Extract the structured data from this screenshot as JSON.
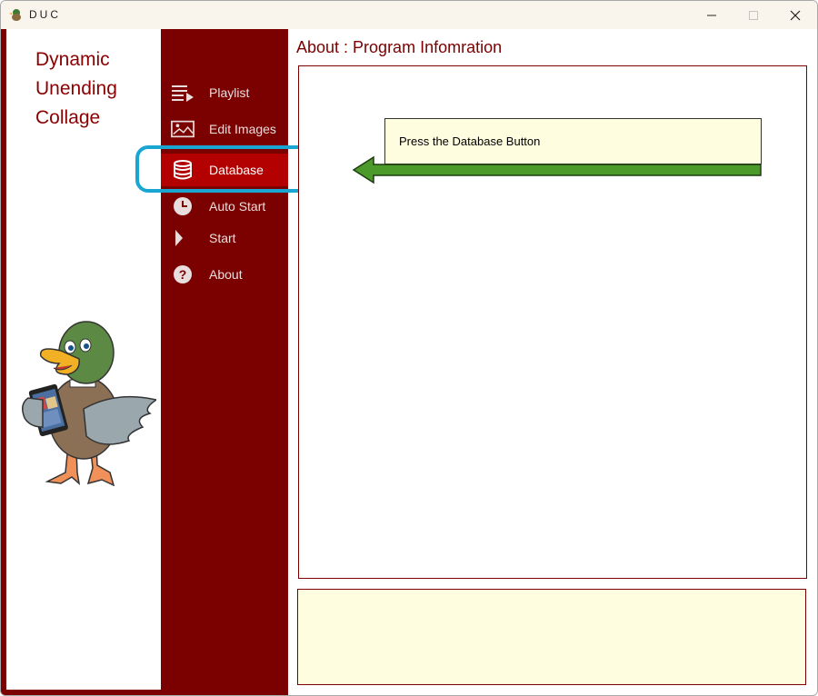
{
  "window": {
    "title": "DUC"
  },
  "logo": {
    "line1": "Dynamic",
    "line2": "Unending",
    "line3": "Collage"
  },
  "nav": {
    "items": [
      {
        "label": "Playlist",
        "icon": "playlist-icon"
      },
      {
        "label": "Edit Images",
        "icon": "image-icon"
      },
      {
        "label": "Database",
        "icon": "database-icon",
        "active": true
      },
      {
        "label": "Auto Start",
        "icon": "clock-icon"
      },
      {
        "label": "Start",
        "icon": "play-icon"
      },
      {
        "label": "About",
        "icon": "help-icon"
      }
    ]
  },
  "main": {
    "title": "About : Program Infomration",
    "tooltip": "Press the Database Button"
  },
  "colors": {
    "brand": "#7b0000",
    "active": "#b30000",
    "highlight": "#1aa6d2",
    "arrow": "#4c9a2a",
    "note_bg": "#fffde0"
  }
}
